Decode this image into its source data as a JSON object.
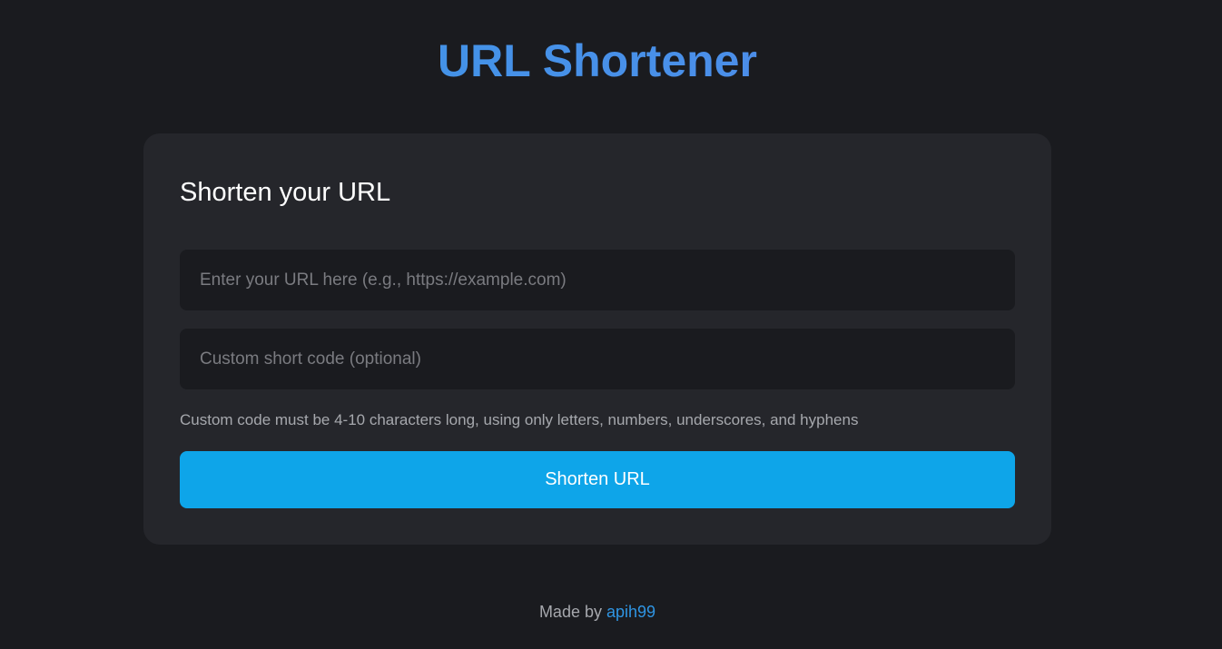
{
  "header": {
    "title": "URL Shortener"
  },
  "form": {
    "heading": "Shorten your URL",
    "url_placeholder": "Enter your URL here (e.g., https://example.com)",
    "url_value": "",
    "code_placeholder": "Custom short code (optional)",
    "code_value": "",
    "hint": "Custom code must be 4-10 characters long, using only letters, numbers, underscores, and hyphens",
    "submit_label": "Shorten URL"
  },
  "footer": {
    "prefix": "Made by ",
    "author_link": "apih99"
  },
  "colors": {
    "background": "#1a1b1f",
    "card": "#25262b",
    "accent": "#0ea5e9",
    "title": "#3b93e6",
    "link": "#2f95e3"
  }
}
